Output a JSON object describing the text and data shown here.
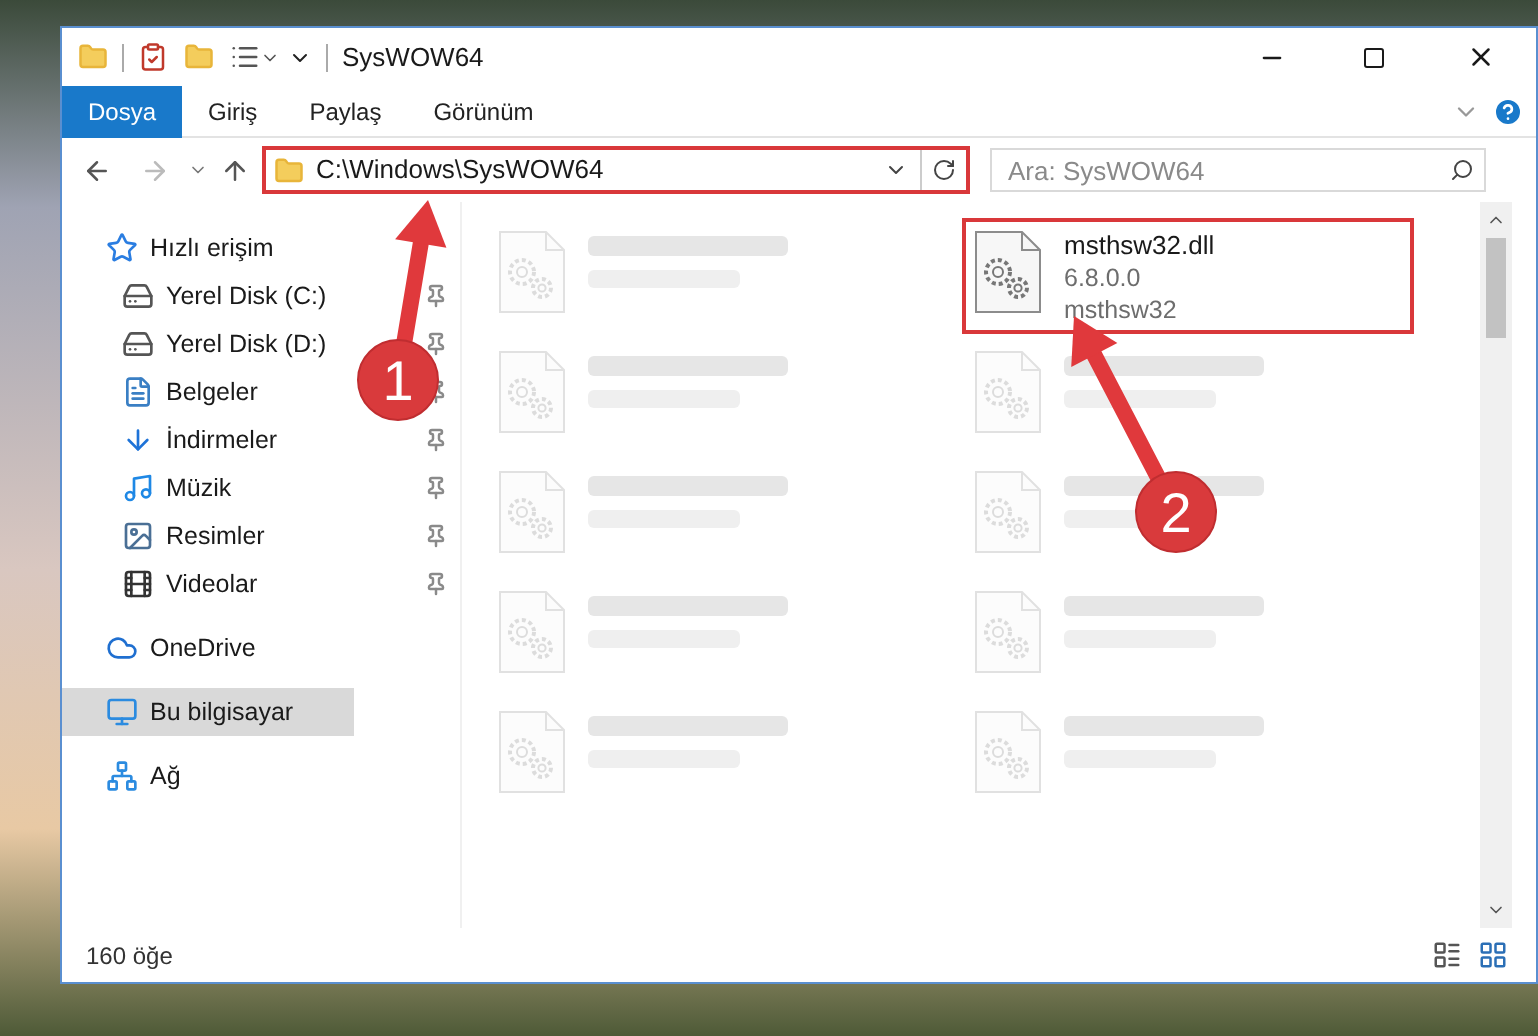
{
  "window": {
    "title": "SysWOW64"
  },
  "ribbon_tabs": [
    {
      "label": "Dosya",
      "selected": true
    },
    {
      "label": "Giriş",
      "selected": false
    },
    {
      "label": "Paylaş",
      "selected": false
    },
    {
      "label": "Görünüm",
      "selected": false
    }
  ],
  "address_bar": {
    "path": "C:\\Windows\\SysWOW64",
    "highlighted": true
  },
  "search": {
    "placeholder": "Ara: SysWOW64"
  },
  "sidebar": {
    "items": [
      {
        "label": "Hızlı erişim",
        "kind": "star",
        "selected": false,
        "children": [
          {
            "label": "Yerel Disk (C:)",
            "kind": "drive-c",
            "selected": false,
            "pinned": true
          },
          {
            "label": "Yerel Disk (D:)",
            "kind": "drive",
            "selected": false,
            "pinned": true
          },
          {
            "label": "Belgeler",
            "kind": "docs",
            "selected": false,
            "pinned": true
          },
          {
            "label": "İndirmeler",
            "kind": "download",
            "selected": false,
            "pinned": true
          },
          {
            "label": "Müzik",
            "kind": "music",
            "selected": false,
            "pinned": true
          },
          {
            "label": "Resimler",
            "kind": "pictures",
            "selected": false,
            "pinned": true
          },
          {
            "label": "Videolar",
            "kind": "videos",
            "selected": false,
            "pinned": true
          }
        ]
      },
      {
        "label": "OneDrive",
        "kind": "cloud",
        "selected": false
      },
      {
        "label": "Bu bilgisayar",
        "kind": "pc",
        "selected": true
      },
      {
        "label": "Ağ",
        "kind": "network",
        "selected": false
      }
    ]
  },
  "files": [
    {
      "blurred": true
    },
    {
      "name": "msthsw32.dll",
      "details": [
        "6.8.0.0",
        "msthsw32"
      ],
      "blurred": false,
      "highlighted": true
    },
    {
      "blurred": true
    },
    {
      "blurred": true
    },
    {
      "blurred": true
    },
    {
      "blurred": true
    },
    {
      "blurred": true
    },
    {
      "blurred": true
    },
    {
      "blurred": true
    },
    {
      "blurred": true
    }
  ],
  "status_bar": {
    "count": "160 öğe"
  },
  "annotations": [
    {
      "number": "1"
    },
    {
      "number": "2"
    }
  ]
}
